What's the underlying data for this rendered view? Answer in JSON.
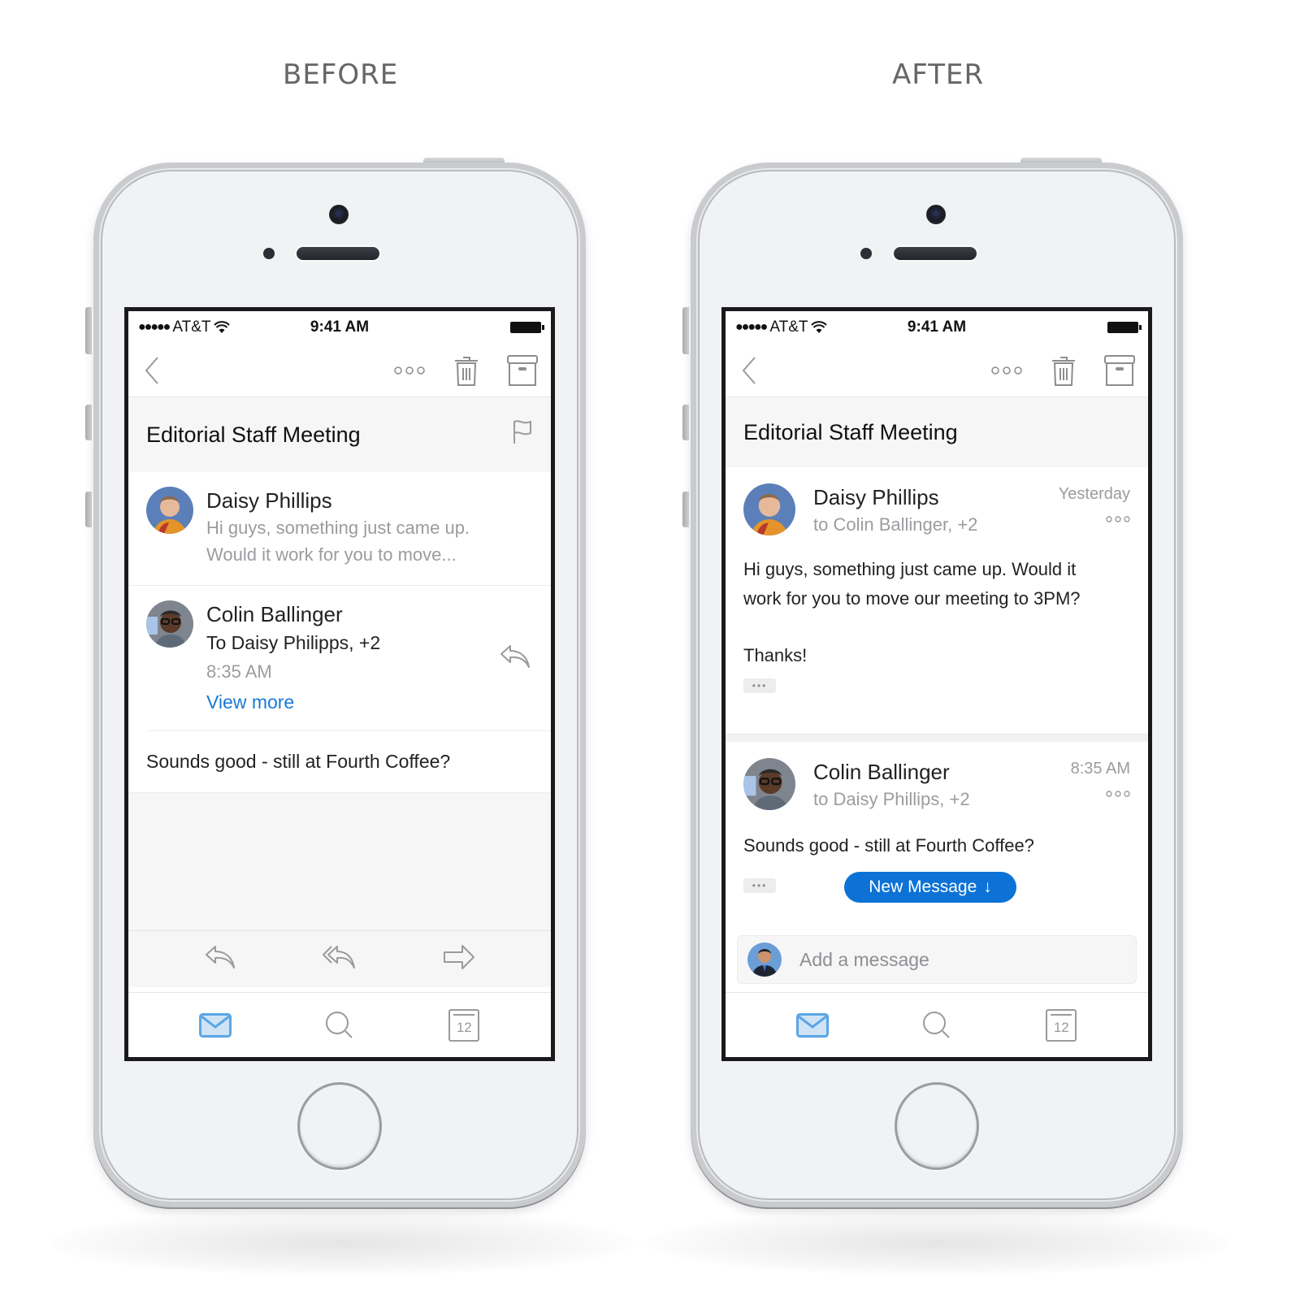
{
  "labels": {
    "before": "BEFORE",
    "after": "AFTER"
  },
  "status_bar": {
    "signal_dots": "●●●●●",
    "carrier": "AT&T",
    "time": "9:41 AM"
  },
  "icons": {
    "back": "chevron-left-icon",
    "more": "more-horizontal-icon",
    "delete": "trash-icon",
    "archive": "archive-icon",
    "flag": "flag-icon",
    "reply": "reply-icon",
    "reply_all": "reply-all-icon",
    "forward": "forward-icon",
    "mail_tab": "mail-icon",
    "search_tab": "search-icon",
    "calendar_tab": "calendar-icon"
  },
  "colors": {
    "accent": "#0d72d6",
    "link": "#1a7ad6",
    "mail_tab_active": "#5aa6e6"
  },
  "before": {
    "subject": "Editorial Staff Meeting",
    "messages": [
      {
        "sender": "Daisy Phillips",
        "snippet_line1": "Hi guys, something just came up.",
        "snippet_line2": "Would it work for you to move..."
      },
      {
        "sender": "Colin Ballinger",
        "recipients": "To Daisy Philipps, +2",
        "time": "8:35 AM",
        "view_more": "View more"
      }
    ],
    "reply_text": "Sounds good - still at Fourth Coffee?",
    "calendar_day": "12"
  },
  "after": {
    "subject": "Editorial Staff Meeting",
    "messages": [
      {
        "sender": "Daisy Phillips",
        "recipients": "to Colin Ballinger, +2",
        "when": "Yesterday",
        "body_line1": "Hi guys, something just came up. Would it",
        "body_line2": "work for you to move our meeting to 3PM?",
        "body_line3": "Thanks!",
        "ellipsis": "•••"
      },
      {
        "sender": "Colin Ballinger",
        "recipients": "to Daisy Phillips, +2",
        "when": "8:35 AM",
        "body": "Sounds good - still at Fourth Coffee?",
        "ellipsis": "•••"
      }
    ],
    "new_message_button": "New Message",
    "new_message_arrow": "↓",
    "compose_placeholder": "Add a message",
    "calendar_day": "12"
  }
}
